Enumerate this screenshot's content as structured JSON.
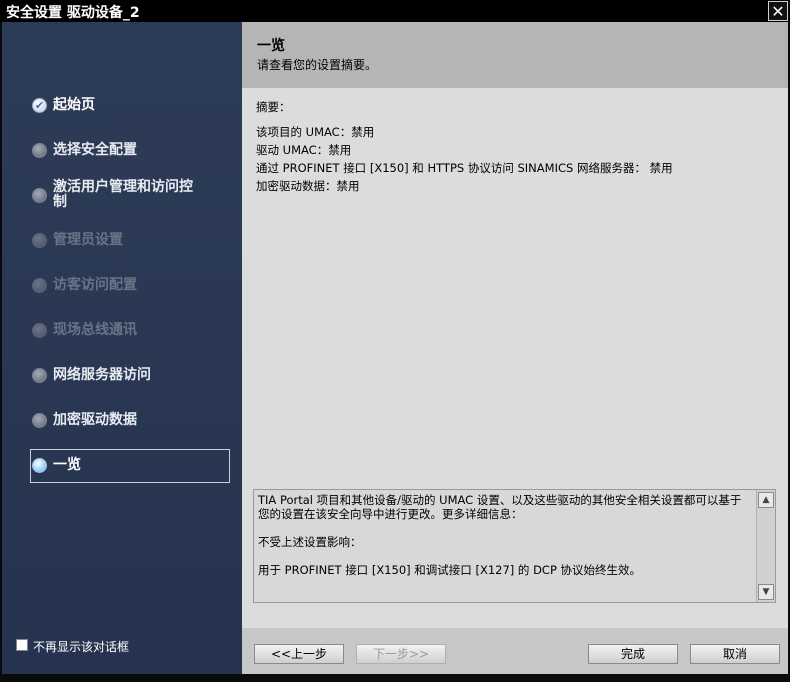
{
  "window": {
    "title": "安全设置 驱动设备_2",
    "close_glyph": "✕"
  },
  "sidebar": {
    "items": [
      {
        "label": "起始页",
        "state": "done"
      },
      {
        "label": "选择安全配置",
        "state": "pending"
      },
      {
        "label": "激活用户管理和访问控制",
        "label_line1": "激活用户管理和访问控",
        "label_line2": "制",
        "state": "pending"
      },
      {
        "label": "管理员设置",
        "state": "disabled"
      },
      {
        "label": "访客访问配置",
        "state": "disabled"
      },
      {
        "label": "现场总线通讯",
        "state": "disabled"
      },
      {
        "label": "网络服务器访问",
        "state": "pending"
      },
      {
        "label": "加密驱动数据",
        "state": "pending"
      },
      {
        "label": "一览",
        "state": "current"
      }
    ],
    "dont_show_label": "不再显示该对话框",
    "dont_show_checked": false
  },
  "header": {
    "title": "一览",
    "subtitle": "请查看您的设置摘要。"
  },
  "summary": {
    "heading": "摘要：",
    "lines": [
      "该项目的 UMAC：禁用",
      "驱动 UMAC：禁用",
      "通过 PROFINET 接口 [X150] 和 HTTPS 协议访问 SINAMICS 网络服务器： 禁用",
      "加密驱动数据：禁用"
    ]
  },
  "info": {
    "para1": "TIA Portal 项目和其他设备/驱动的 UMAC 设置、以及这些驱动的其他安全相关设置都可以基于您的设置在该安全向导中进行更改。更多详细信息：",
    "para2": "不受上述设置影响：",
    "para3": "用于 PROFINET 接口 [X150] 和调试接口 [X127] 的 DCP 协议始终生效。",
    "scroll_up_glyph": "▲",
    "scroll_down_glyph": "▼"
  },
  "footer": {
    "back_label": "<<上一步",
    "next_label": "下一步>>",
    "finish_label": "完成",
    "cancel_label": "取消"
  }
}
